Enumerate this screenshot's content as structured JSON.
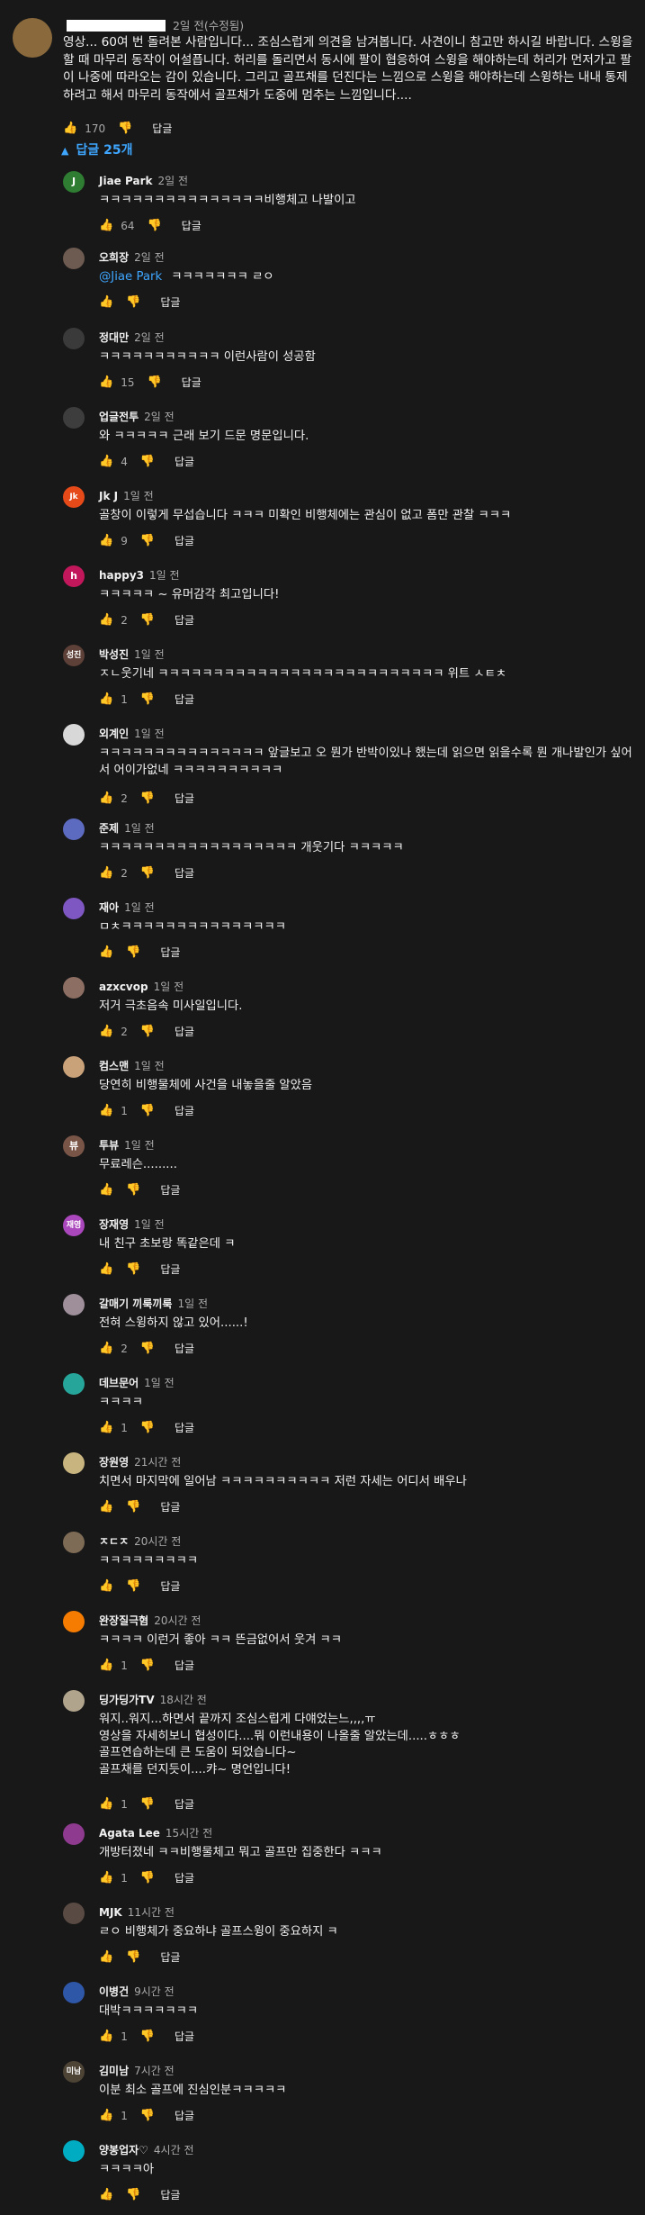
{
  "top_comment": {
    "time": "2일 전(수정됨)",
    "text": "영상... 60여 번 돌려본 사람입니다... 조심스럽게 의견을 남겨봅니다. 사견이니 참고만 하시길 바랍니다. 스윙을 할 때 마무리 동작이 어설픕니다. 허리를 돌리면서 동시에 팔이 협응하여 스윙을 해야하는데 허리가 먼저가고 팔이 나중에 따라오는 감이 있습니다. 그리고 골프채를 던진다는 느낌으로 스윙을 해야하는데 스윙하는 내내 통제하려고 해서 마무리 동작에서 골프채가 도중에 멈추는 느낌입니다....",
    "likes": "170",
    "reply_label": "답글"
  },
  "replies_toggle": "답글 25개",
  "icons": {
    "like": "thumbs-up-icon",
    "dislike": "thumbs-down-icon",
    "chevron": "chevron-up-icon"
  },
  "colors": {
    "link": "#3ea6ff",
    "background": "#181818"
  },
  "replies": [
    {
      "author": "Jiae Park",
      "time": "2일 전",
      "text": "ㅋㅋㅋㅋㅋㅋㅋㅋㅋㅋㅋㅋㅋㅋㅋ비행체고 나발이고",
      "likes": "64",
      "reply": "답글",
      "avatar_letter": "J",
      "avatar_color": "#2e7d32"
    },
    {
      "author": "오희장",
      "time": "2일 전",
      "mention": "@Jiae Park",
      "text": "ㅋㅋㅋㅋㅋㅋㅋ ㄹㅇ",
      "likes": "",
      "reply": "답글",
      "avatar_letter": "",
      "avatar_color": "#6d5a50"
    },
    {
      "author": "정대만",
      "time": "2일 전",
      "text": "ㅋㅋㅋㅋㅋㅋㅋㅋㅋㅋㅋ 이런사람이 성공함",
      "likes": "15",
      "reply": "답글",
      "avatar_letter": "",
      "avatar_color": "#3a3a3a"
    },
    {
      "author": "업글전투",
      "time": "2일 전",
      "text": "와 ㅋㅋㅋㅋㅋ 근래 보기 드문 명문입니다.",
      "likes": "4",
      "reply": "답글",
      "avatar_letter": "",
      "avatar_color": "#3d3d3d"
    },
    {
      "author": "Jk J",
      "time": "1일 전",
      "text": "골창이 이렇게 무섭습니다 ㅋㅋㅋ 미확인 비행체에는 관심이 없고 폼만 관찰 ㅋㅋㅋ",
      "likes": "9",
      "reply": "답글",
      "avatar_letter": "Jk",
      "avatar_color": "#e64a19"
    },
    {
      "author": "happy3",
      "time": "1일 전",
      "text": "ㅋㅋㅋㅋㅋ ~ 유머감각 최고입니다!",
      "likes": "2",
      "reply": "답글",
      "avatar_letter": "h",
      "avatar_color": "#c2185b"
    },
    {
      "author": "박성진",
      "time": "1일 전",
      "text": "ㅈㄴ웃기네 ㅋㅋㅋㅋㅋㅋㅋㅋㅋㅋㅋㅋㅋㅋㅋㅋㅋㅋㅋㅋㅋㅋㅋㅋㅋㅋ 위트 ㅅㅌㅊ",
      "likes": "1",
      "reply": "답글",
      "avatar_letter": "성진",
      "avatar_color": "#5d4037"
    },
    {
      "author": "외계인",
      "time": "1일 전",
      "text": "ㅋㅋㅋㅋㅋㅋㅋㅋㅋㅋㅋㅋㅋㅋㅋ 앞글보고 오 뭔가 반박이있나 했는데 읽으면 읽을수록 뭔 개나발인가 싶어서 어이가없네 ㅋㅋㅋㅋㅋㅋㅋㅋㅋㅋ",
      "likes": "2",
      "reply": "답글",
      "avatar_letter": "",
      "avatar_color": "#d8d8d8"
    },
    {
      "author": "준제",
      "time": "1일 전",
      "text": "ㅋㅋㅋㅋㅋㅋㅋㅋㅋㅋㅋㅋㅋㅋㅋㅋㅋㅋ 개웃기다 ㅋㅋㅋㅋㅋ",
      "likes": "2",
      "reply": "답글",
      "avatar_letter": "",
      "avatar_color": "#5c6bc0"
    },
    {
      "author": "재아",
      "time": "1일 전",
      "text": "ㅁㅊㅋㅋㅋㅋㅋㅋㅋㅋㅋㅋㅋㅋㅋㅋㅋ",
      "likes": "",
      "reply": "답글",
      "avatar_letter": "",
      "avatar_color": "#7e57c2"
    },
    {
      "author": "azxcvop",
      "time": "1일 전",
      "text": "저거 극초음속 미사일입니다.",
      "likes": "2",
      "reply": "답글",
      "avatar_letter": "",
      "avatar_color": "#8d6e63"
    },
    {
      "author": "컴스맨",
      "time": "1일 전",
      "text": "당연히 비행물체에 사건을 내놓을줄 알았음",
      "likes": "1",
      "reply": "답글",
      "avatar_letter": "",
      "avatar_color": "#c9a27a"
    },
    {
      "author": "투뷰",
      "time": "1일 전",
      "text": "무료레슨.........",
      "likes": "",
      "reply": "답글",
      "avatar_letter": "뷰",
      "avatar_color": "#795548"
    },
    {
      "author": "장재영",
      "time": "1일 전",
      "text": "내 친구 초보랑  똑같은데 ㅋ",
      "likes": "",
      "reply": "답글",
      "avatar_letter": "재영",
      "avatar_color": "#ab47bc"
    },
    {
      "author": "갈매기 끼룩끼룩",
      "time": "1일 전",
      "text": "전혀 스윙하지 않고 있어......!",
      "likes": "2",
      "reply": "답글",
      "avatar_letter": "",
      "avatar_color": "#9e8f9b"
    },
    {
      "author": "데브문어",
      "time": "1일 전",
      "text": "ㅋㅋㅋㅋ",
      "likes": "1",
      "reply": "답글",
      "avatar_letter": "",
      "avatar_color": "#26a69a"
    },
    {
      "author": "장원영",
      "time": "21시간 전",
      "text": "치면서 마지막에 일어남 ㅋㅋㅋㅋㅋㅋㅋㅋㅋㅋ 저런 자세는 어디서 배우나",
      "likes": "",
      "reply": "답글",
      "avatar_letter": "",
      "avatar_color": "#c8b47e"
    },
    {
      "author": "ㅈㄷㅈ",
      "time": "20시간 전",
      "text": "ㅋㅋㅋㅋㅋㅋㅋㅋㅋ",
      "likes": "",
      "reply": "답글",
      "avatar_letter": "",
      "avatar_color": "#7d6b55"
    },
    {
      "author": "완장질극혐",
      "time": "20시간 전",
      "text": "ㅋㅋㅋㅋ 이런거 좋아 ㅋㅋ 뜬금없어서 웃겨 ㅋㅋ",
      "likes": "1",
      "reply": "답글",
      "avatar_letter": "",
      "avatar_color": "#f57c00"
    },
    {
      "author": "딩가딩가TV",
      "time": "18시간 전",
      "text": "워지..워지...하면서 끝까지 조심스럽게 다얘었는느,,,,ㅠ\n영상을 자세히보니 협성이다....뭐 이런내용이 나올줄 알았는데.....ㅎㅎㅎ\n골프연습하는데 큰 도움이 되었습니다~\n골프채를 던지듯이....캬~ 명언입니다!",
      "likes": "1",
      "reply": "답글",
      "avatar_letter": "",
      "avatar_color": "#b0a48c"
    },
    {
      "author": "Agata Lee",
      "time": "15시간 전",
      "text": "개방터졌네 ㅋㅋ비행물체고 뭐고 골프만 집중한다 ㅋㅋㅋ",
      "likes": "1",
      "reply": "답글",
      "avatar_letter": "",
      "avatar_color": "#8e3a8e"
    },
    {
      "author": "MJK",
      "time": "11시간 전",
      "text": "ㄹㅇ 비행체가 중요하냐 골프스윙이 중요하지 ㅋ",
      "likes": "",
      "reply": "답글",
      "avatar_letter": "",
      "avatar_color": "#5a4a44"
    },
    {
      "author": "이병건",
      "time": "9시간 전",
      "text": "대박ㅋㅋㅋㅋㅋㅋㅋ",
      "likes": "1",
      "reply": "답글",
      "avatar_letter": "",
      "avatar_color": "#2f57a8"
    },
    {
      "author": "김미남",
      "time": "7시간 전",
      "text": "이분 최소 골프에 진심인분ㅋㅋㅋㅋㅋ",
      "likes": "1",
      "reply": "답글",
      "avatar_letter": "미남",
      "avatar_color": "#4e4436"
    },
    {
      "author": "양봉업자♡",
      "time": "4시간 전",
      "text": "ㅋㅋㅋㅋ아",
      "likes": "",
      "reply": "답글",
      "avatar_letter": "",
      "avatar_color": "#00acc1"
    }
  ]
}
